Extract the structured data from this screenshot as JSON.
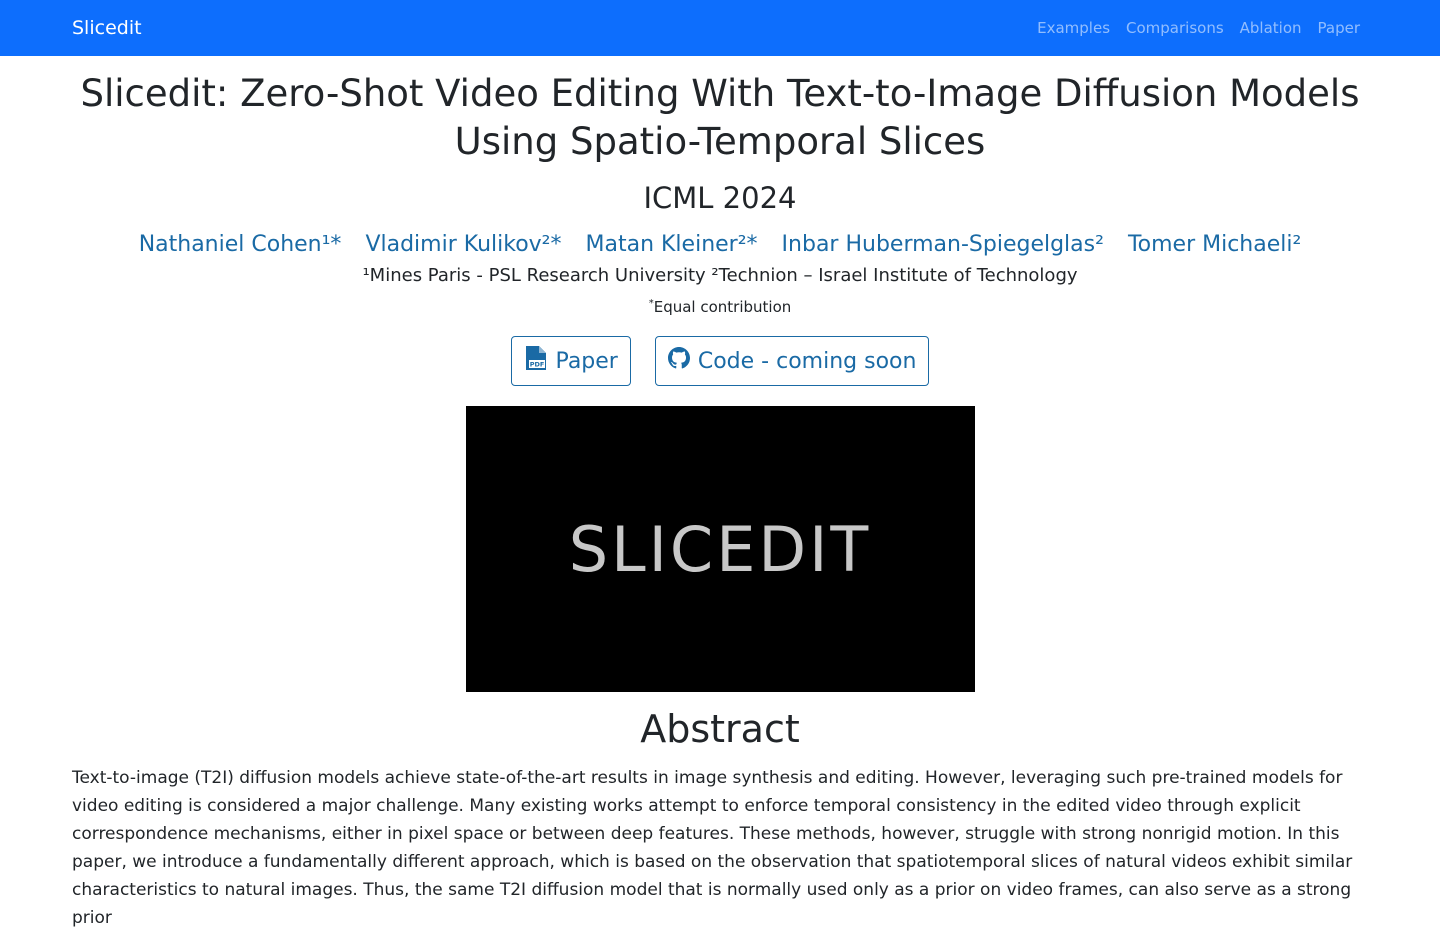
{
  "navbar": {
    "brand": "Slicedit",
    "links": [
      "Examples",
      "Comparisons",
      "Ablation",
      "Paper"
    ]
  },
  "header": {
    "title": "Slicedit: Zero-Shot Video Editing With Text-to-Image Diffusion Models Using Spatio-Temporal Slices",
    "venue": "ICML 2024",
    "authors": [
      "Nathaniel Cohen¹*",
      "Vladimir Kulikov²*",
      "Matan Kleiner²*",
      "Inbar Huberman-Spiegelglas²",
      "Tomer Michaeli²"
    ],
    "affiliations": "¹Mines Paris - PSL Research University ²Technion – Israel Institute of Technology",
    "equal_mark": "*",
    "equal_text": "Equal contribution"
  },
  "buttons": {
    "paper": "Paper",
    "code": "Code - coming soon"
  },
  "video": {
    "overlay_text": "SLICEDIT"
  },
  "abstract": {
    "heading": "Abstract",
    "text": "Text-to-image (T2I) diffusion models achieve state-of-the-art results in image synthesis and editing. However, leveraging such pre-trained models for video editing is considered a major challenge. Many existing works attempt to enforce temporal consistency in the edited video through explicit correspondence mechanisms, either in pixel space or between deep features. These methods, however, struggle with strong nonrigid motion. In this paper, we introduce a fundamentally different approach, which is based on the observation that spatiotemporal slices of natural videos exhibit similar characteristics to natural images. Thus, the same T2I diffusion model that is normally used only as a prior on video frames, can also serve as a strong prior"
  },
  "colors": {
    "navbar_bg": "#0d6efd",
    "link": "#1a6aa5"
  },
  "icons": {
    "paper_button": "file-pdf-icon",
    "code_button": "github-icon"
  }
}
